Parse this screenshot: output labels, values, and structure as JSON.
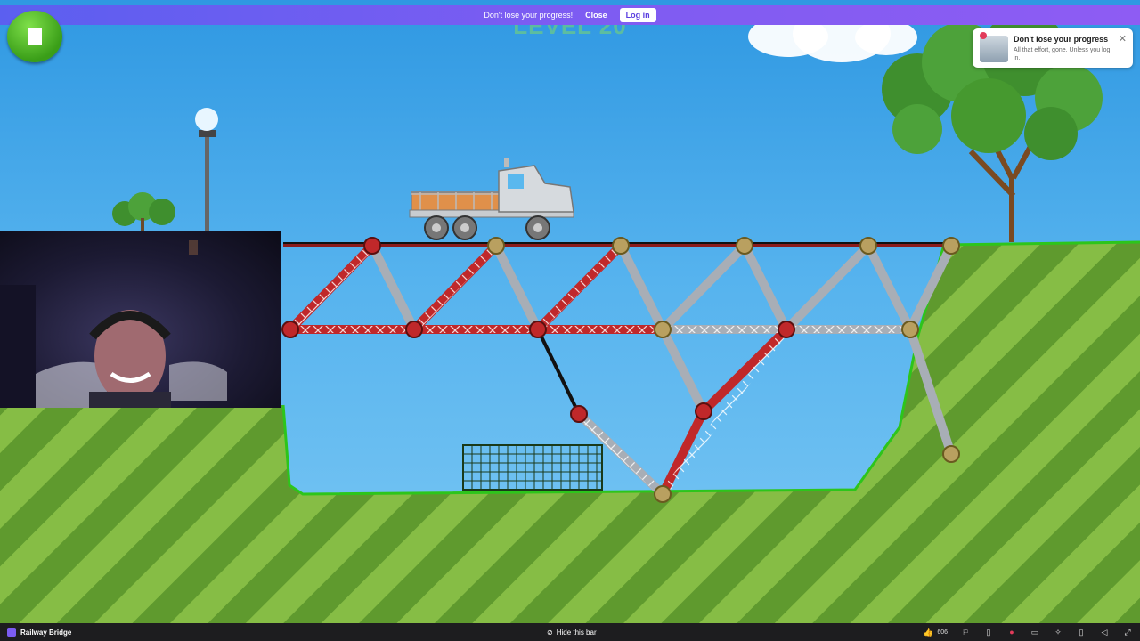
{
  "banner": {
    "message": "Don't lose your progress!",
    "close_label": "Close",
    "login_label": "Log in"
  },
  "game": {
    "level_title": "LEVEL 20",
    "stop_button_icon": "stop-icon"
  },
  "notification": {
    "title": "Don't lose your progress",
    "message": "All that effort, gone. Unless you log in.",
    "close_icon": "close-icon"
  },
  "bottom_bar": {
    "game_title": "Railway Bridge",
    "hide_label": "Hide this bar",
    "like_count": "606",
    "icons": [
      "thumbs-up-icon",
      "thumbs-down-icon",
      "bookmark-icon",
      "record-icon",
      "comment-icon",
      "settings-icon",
      "phone-icon",
      "volume-icon",
      "fullscreen-icon"
    ]
  },
  "colors": {
    "sky": "#3aa0e6",
    "grass_light": "#8cc34a",
    "grass_dark": "#5f9a2e",
    "steel_red": "#c0282a",
    "steel_grey": "#a8aeb6",
    "banner_purple": "#7d5cf2"
  }
}
